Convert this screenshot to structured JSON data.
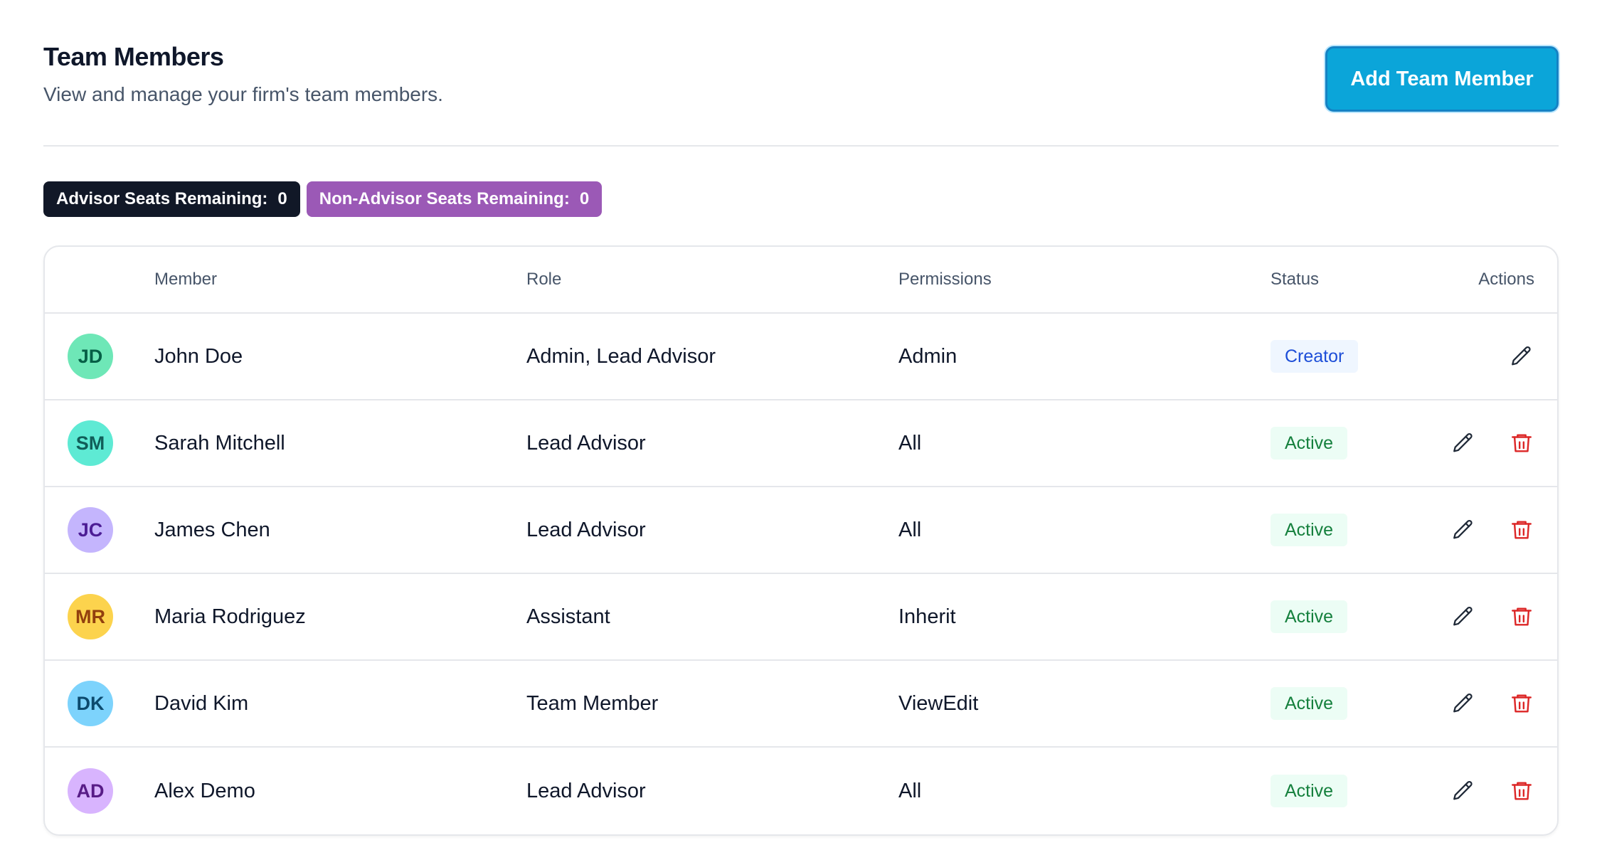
{
  "header": {
    "title": "Team Members",
    "subtitle": "View and manage your firm's team members.",
    "add_button_label": "Add Team Member"
  },
  "seats": {
    "advisor_label": "Advisor Seats Remaining:",
    "advisor_value": "0",
    "non_advisor_label": "Non-Advisor Seats Remaining:",
    "non_advisor_value": "0"
  },
  "table": {
    "columns": {
      "member": "Member",
      "role": "Role",
      "permissions": "Permissions",
      "status": "Status",
      "actions": "Actions"
    },
    "rows": [
      {
        "initials": "JD",
        "name": "John Doe",
        "role": "Admin, Lead Advisor",
        "permissions": "Admin",
        "status": "Creator"
      },
      {
        "initials": "SM",
        "name": "Sarah Mitchell",
        "role": "Lead Advisor",
        "permissions": "All",
        "status": "Active"
      },
      {
        "initials": "JC",
        "name": "James Chen",
        "role": "Lead Advisor",
        "permissions": "All",
        "status": "Active"
      },
      {
        "initials": "MR",
        "name": "Maria Rodriguez",
        "role": "Assistant",
        "permissions": "Inherit",
        "status": "Active"
      },
      {
        "initials": "DK",
        "name": "David Kim",
        "role": "Team Member",
        "permissions": "ViewEdit",
        "status": "Active"
      },
      {
        "initials": "AD",
        "name": "Alex Demo",
        "role": "Lead Advisor",
        "permissions": "All",
        "status": "Active"
      }
    ]
  },
  "colors": {
    "primary_button": "#0ba5d9",
    "advisor_badge": "#111827",
    "non_advisor_badge": "#9b59b6",
    "delete_icon": "#dc2626",
    "avatar_jd": "#6ee7b7",
    "avatar_sm": "#5eead4",
    "avatar_jc": "#c4b5fd",
    "avatar_mr": "#fcd34d",
    "avatar_dk": "#7dd3fc",
    "avatar_ad": "#d8b4fe"
  }
}
